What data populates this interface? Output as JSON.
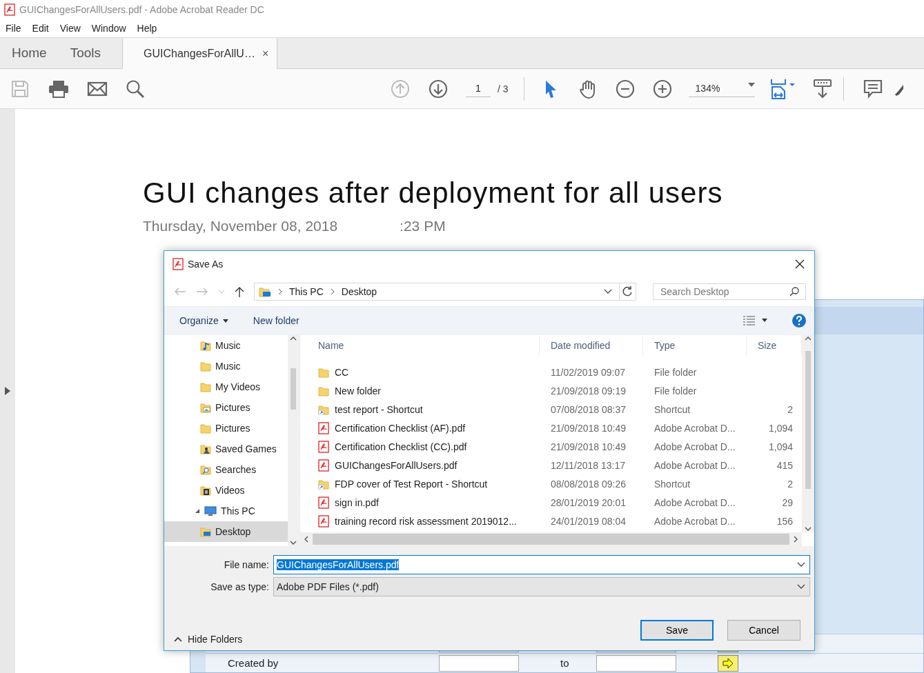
{
  "window": {
    "title": "GUIChangesForAllUsers.pdf - Adobe Acrobat Reader DC"
  },
  "menu": [
    "File",
    "Edit",
    "View",
    "Window",
    "Help"
  ],
  "tabs": [
    {
      "label": "Home",
      "selected": false
    },
    {
      "label": "Tools",
      "selected": false
    },
    {
      "label": "GUIChangesForAllU…",
      "selected": true,
      "close": "×"
    }
  ],
  "toolbar": {
    "page": "1",
    "page_total": "/ 3",
    "zoom": "134%"
  },
  "document": {
    "heading": "GUI changes after deployment for all users",
    "date": "Thursday, November 08, 2018",
    "time": ":23 PM",
    "form_rows": [
      {
        "label": "Created by",
        "to": "to"
      }
    ]
  },
  "dialog": {
    "title": "Save As",
    "breadcrumb": [
      "This PC",
      "Desktop"
    ],
    "search": {
      "placeholder": "Search Desktop"
    },
    "commands": [
      "Organize",
      "New folder"
    ],
    "tree": [
      {
        "label": "Music",
        "kind": "music",
        "selected": false
      },
      {
        "label": "Music",
        "kind": "folder",
        "selected": false
      },
      {
        "label": "My Videos",
        "kind": "folder",
        "selected": false
      },
      {
        "label": "Pictures",
        "kind": "pictures",
        "selected": false
      },
      {
        "label": "Pictures",
        "kind": "folder",
        "selected": false
      },
      {
        "label": "Saved Games",
        "kind": "games",
        "selected": false
      },
      {
        "label": "Searches",
        "kind": "searches",
        "selected": false
      },
      {
        "label": "Videos",
        "kind": "videos",
        "selected": false
      },
      {
        "label": "This PC",
        "kind": "pc",
        "selected": false,
        "expanded": true,
        "children": [
          {
            "label": "Desktop",
            "kind": "desktop",
            "selected": true
          }
        ]
      }
    ],
    "columns": [
      "Name",
      "Date modified",
      "Type",
      "Size"
    ],
    "files": [
      {
        "kind": "folder",
        "name": "CC",
        "date": "11/02/2019 09:07",
        "type": "File folder"
      },
      {
        "kind": "folder",
        "name": "New folder",
        "date": "21/09/2018 09:19",
        "type": "File folder"
      },
      {
        "kind": "shortcut",
        "name": "test report - Shortcut",
        "date": "07/08/2018 08:37",
        "type": "Shortcut",
        "size": "2"
      },
      {
        "kind": "pdf",
        "name": "Certification Checklist (AF).pdf",
        "date": "21/09/2018 10:49",
        "type": "Adobe Acrobat D...",
        "size": "1,094"
      },
      {
        "kind": "pdf",
        "name": "Certification Checklist (CC).pdf",
        "date": "21/09/2018 10:49",
        "type": "Adobe Acrobat D...",
        "size": "1,094"
      },
      {
        "kind": "pdf",
        "name": "GUIChangesForAllUsers.pdf",
        "date": "12/11/2018 13:17",
        "type": "Adobe Acrobat D...",
        "size": "415"
      },
      {
        "kind": "shortcut",
        "name": "FDP cover of Test Report - Shortcut",
        "date": "08/08/2018 09:26",
        "type": "Shortcut",
        "size": "2"
      },
      {
        "kind": "pdf",
        "name": "sign in.pdf",
        "date": "28/01/2019 20:01",
        "type": "Adobe Acrobat D...",
        "size": "29"
      },
      {
        "kind": "pdf",
        "name": "training record risk assessment 2019012...",
        "date": "24/01/2019 08:04",
        "type": "Adobe Acrobat D...",
        "size": "156"
      }
    ],
    "file_name_label": "File name:",
    "file_name": "GUIChangesForAllUsers.pdf",
    "type_label": "Save as type:",
    "save_type": "Adobe PDF Files (*.pdf)",
    "hide_folders": "Hide Folders",
    "buttons": [
      {
        "label": "Save",
        "default": true
      },
      {
        "label": "Cancel",
        "default": false
      }
    ]
  }
}
